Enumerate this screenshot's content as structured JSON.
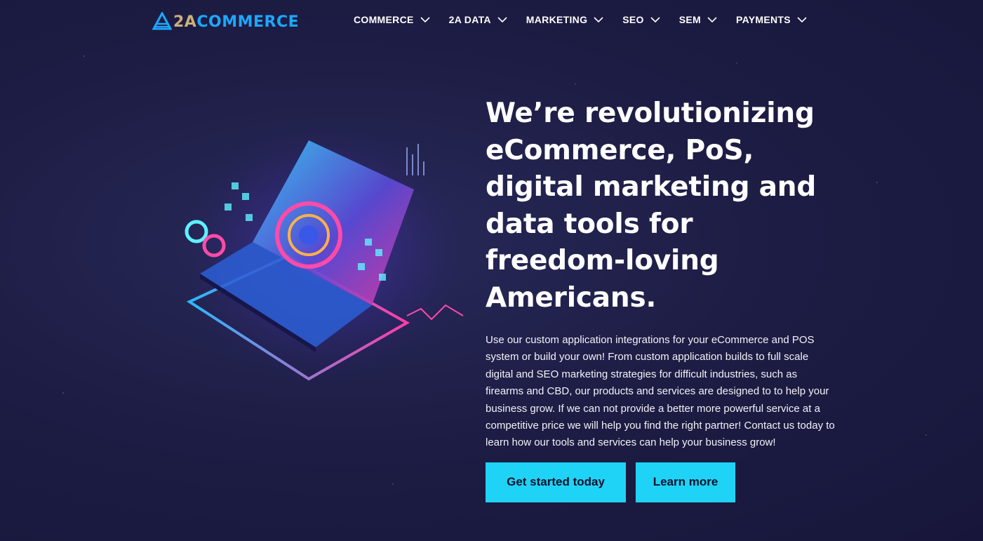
{
  "brand": {
    "logo_part1": "2A",
    "logo_part2": "COMMERCE"
  },
  "nav": {
    "items": [
      {
        "label": "COMMERCE"
      },
      {
        "label": "2A DATA"
      },
      {
        "label": "MARKETING"
      },
      {
        "label": "SEO"
      },
      {
        "label": "SEM"
      },
      {
        "label": "PAYMENTS"
      }
    ]
  },
  "hero": {
    "headline": "We’re revolutionizing eCommerce, PoS, digital marketing and data tools for freedom-loving Americans.",
    "description": "Use our custom application integrations for your eCommerce and POS system or build your own! From custom application builds to full scale digital and SEO marketing strategies for difficult industries, such as firearms and CBD, our products and services are designed to to help your business grow. If we can not provide a better more powerful service at a competitive price we will help you find the right partner! Contact us today to learn how our tools and services can help your business grow!",
    "primary_button": "Get started today",
    "secondary_button": "Learn more"
  },
  "colors": {
    "accent": "#1fd3f7",
    "background": "#1d1d45",
    "logo_gold": "#c9b27a",
    "logo_blue": "#1ea7ff"
  },
  "icons": [
    "logo-icon",
    "chevron-down-icon",
    "laptop-illustration"
  ]
}
